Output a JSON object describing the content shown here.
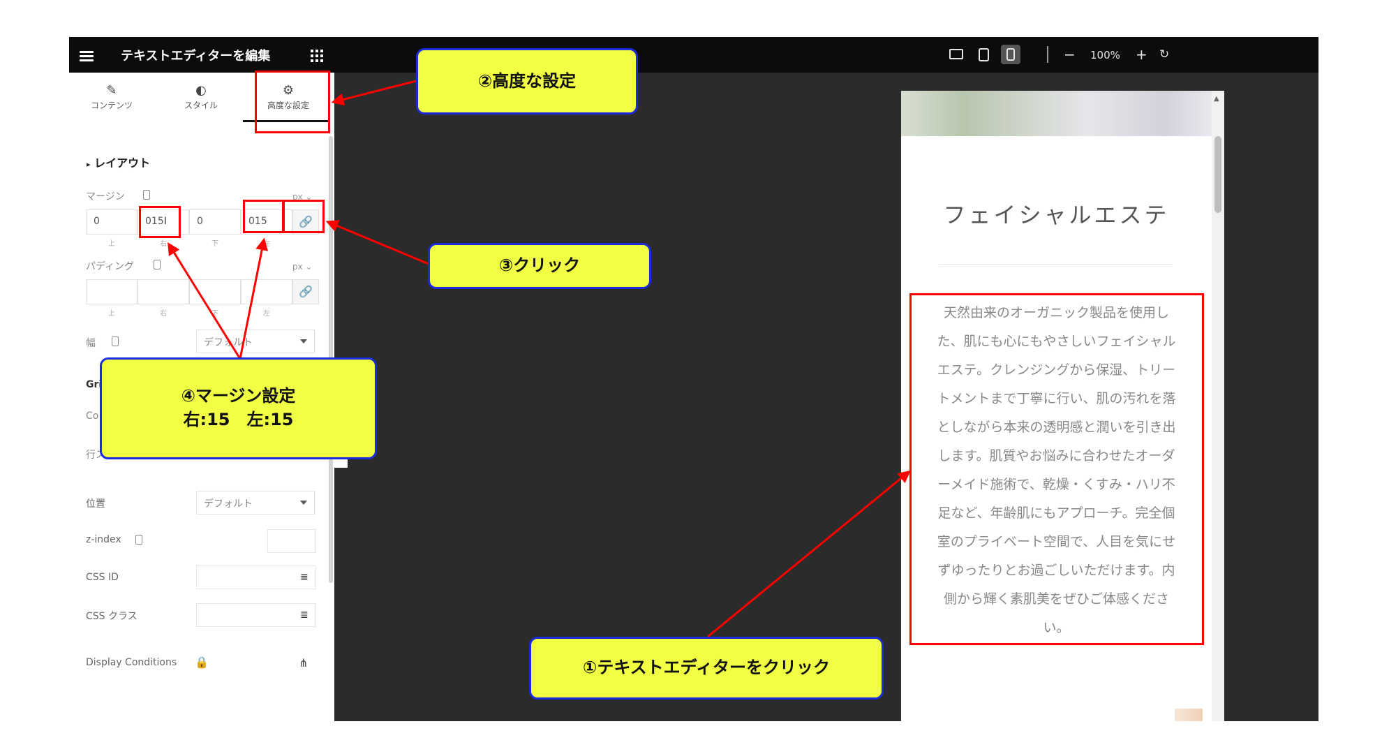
{
  "panel": {
    "title": "テキストエディターを編集",
    "tabs": [
      {
        "label": "コンテンツ",
        "icon": "pencil-icon"
      },
      {
        "label": "スタイル",
        "icon": "contrast-icon"
      },
      {
        "label": "高度な設定",
        "icon": "gear-icon"
      }
    ],
    "section_title": "レイアウト",
    "margin": {
      "label": "マージン",
      "unit": "px",
      "values": [
        "0",
        "015",
        "0",
        "015"
      ],
      "sub_labels": [
        "上",
        "右",
        "下",
        "左"
      ]
    },
    "padding": {
      "label": "パディング",
      "unit": "px",
      "sub_labels": [
        "上",
        "右",
        "下",
        "左"
      ]
    },
    "width": {
      "label": "幅",
      "value": "デフォルト"
    },
    "grid_label": "Gri",
    "co_label": "Co",
    "row_label": "行ス",
    "position": {
      "label": "位置",
      "value": "デフォルト"
    },
    "zindex_label": "z-index",
    "css_id_label": "CSS ID",
    "css_class_label": "CSS クラス",
    "display_conditions_label": "Display Conditions"
  },
  "toolbar": {
    "zoom": "100%",
    "minus": "−",
    "plus": "+",
    "reset": "↻"
  },
  "preview": {
    "title": "フェイシャルエステ",
    "lines": [
      "天然由来のオーガニック製品を使用し",
      "た、肌にも心にもやさしいフェイシャル",
      "エステ。クレンジングから保湿、トリー",
      "トメントまで丁寧に行い、肌の汚れを落",
      "としながら本来の透明感と潤いを引き出",
      "します。肌質やお悩みに合わせたオーダ",
      "ーメイド施術で、乾燥・くすみ・ハリ不",
      "足など、年齢肌にもアプローチ。完全個",
      "室のプライベート空間で、人目を気にせ",
      "ずゆったりとお過ごしいただけます。内",
      "側から輝く素肌美をぜひご体感くださ",
      "い。"
    ]
  },
  "callouts": {
    "step1": "①テキストエディターをクリック",
    "step2": "②高度な設定",
    "step3": "③クリック",
    "step4_line1": "④マージン設定",
    "step4_line2": "右:15　左:15"
  },
  "colors": {
    "callout_fill": "#f1ff44",
    "callout_border": "#1b2bdc",
    "highlight_red": "#ff0000",
    "editor_dark": "#2b2b2b"
  }
}
